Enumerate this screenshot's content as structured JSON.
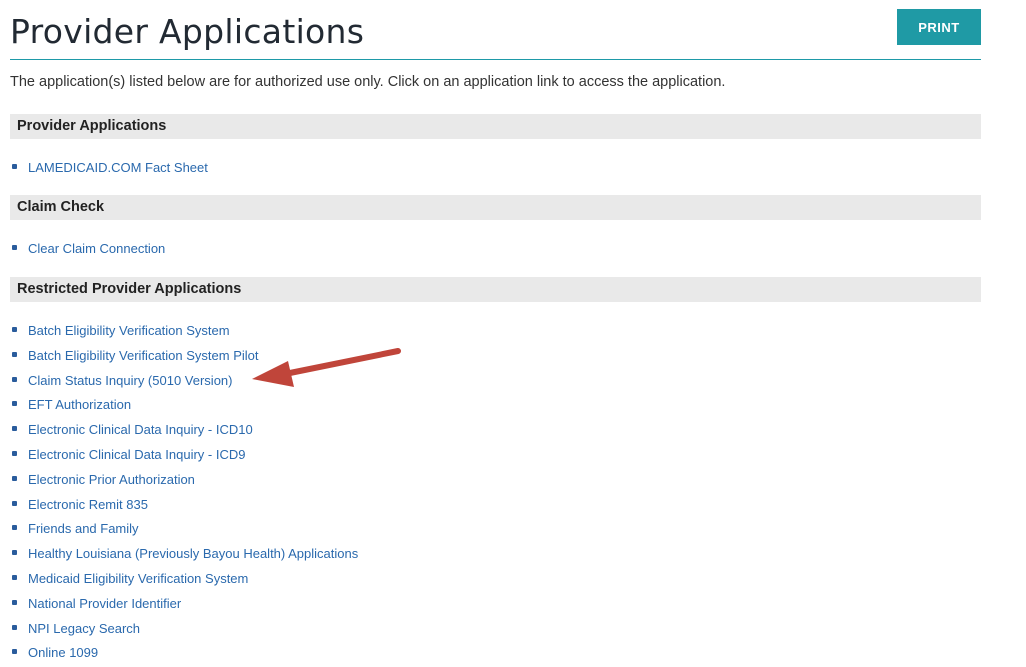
{
  "header": {
    "title": "Provider Applications",
    "print_label": "PRINT"
  },
  "intro": "The application(s) listed below are for authorized use only. Click on an application link to access the application.",
  "sections": [
    {
      "title": "Provider Applications",
      "links": [
        "LAMEDICAID.COM Fact Sheet"
      ]
    },
    {
      "title": "Claim Check",
      "links": [
        "Clear Claim Connection"
      ]
    },
    {
      "title": "Restricted Provider Applications",
      "links": [
        "Batch Eligibility Verification System",
        "Batch Eligibility Verification System Pilot",
        "Claim Status Inquiry (5010 Version)",
        "EFT Authorization",
        "Electronic Clinical Data Inquiry - ICD10",
        "Electronic Clinical Data Inquiry - ICD9",
        "Electronic Prior Authorization",
        "Electronic Remit 835",
        "Friends and Family",
        "Healthy Louisiana (Previously Bayou Health) Applications",
        "Medicaid Eligibility Verification System",
        "National Provider Identifier",
        "NPI Legacy Search",
        "Online 1099"
      ]
    }
  ],
  "colors": {
    "accent": "#1f9aa5",
    "link": "#2a69ad",
    "section_bg": "#e9e9e9",
    "arrow": "#c0453a"
  },
  "annotation_icon": "red-arrow-icon"
}
